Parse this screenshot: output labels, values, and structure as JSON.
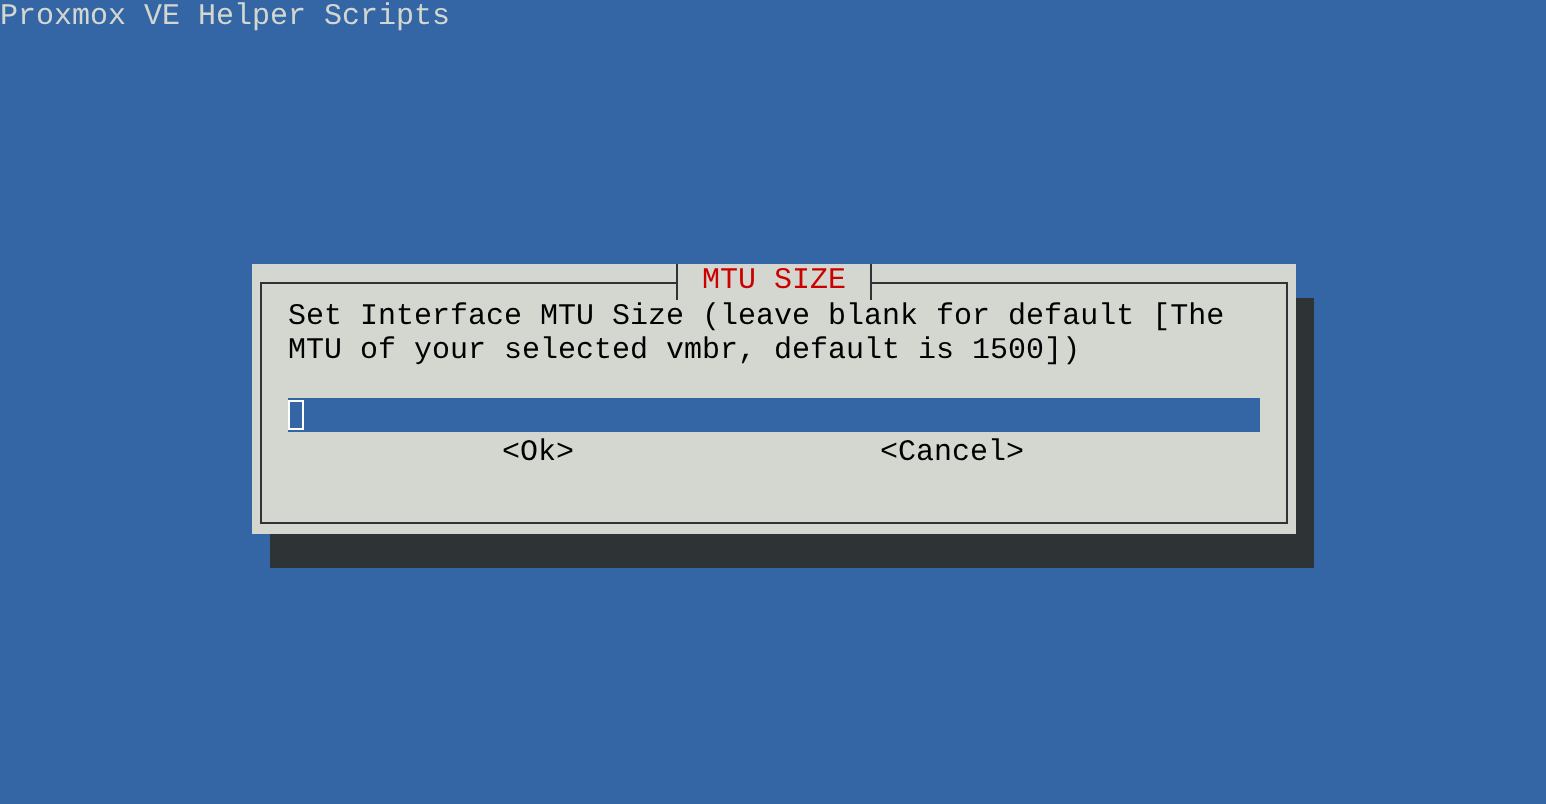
{
  "backtitle": "Proxmox VE Helper Scripts",
  "dialog": {
    "title": "MTU SIZE",
    "prompt": "Set Interface MTU Size (leave blank for default [The MTU of your selected vmbr, default is 1500])",
    "input": {
      "focused": true
    },
    "buttons": [
      {
        "label": "<Ok>",
        "selected": false
      },
      {
        "label": "<Cancel>",
        "selected": false
      }
    ]
  }
}
